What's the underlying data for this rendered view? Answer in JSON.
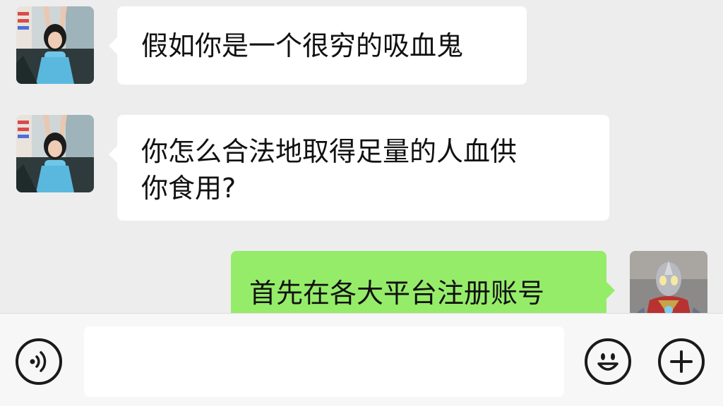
{
  "colors": {
    "chat_background": "#ededed",
    "incoming_bubble": "#ffffff",
    "outgoing_bubble": "#95ec69",
    "input_bar": "#f7f7f7"
  },
  "messages": [
    {
      "direction": "incoming",
      "avatar": "girl-photo-avatar",
      "text": "假如你是一个很穷的吸血鬼"
    },
    {
      "direction": "incoming",
      "avatar": "girl-photo-avatar",
      "text": "你怎么合法地取得足量的人血供\n你食用?"
    },
    {
      "direction": "outgoing",
      "avatar": "ultraman-avatar",
      "text": "首先在各大平台注册账号"
    }
  ],
  "input_bar": {
    "voice_icon": "voice-icon",
    "message_value": "",
    "emoji_icon": "emoji-icon",
    "plus_icon": "plus-icon"
  }
}
